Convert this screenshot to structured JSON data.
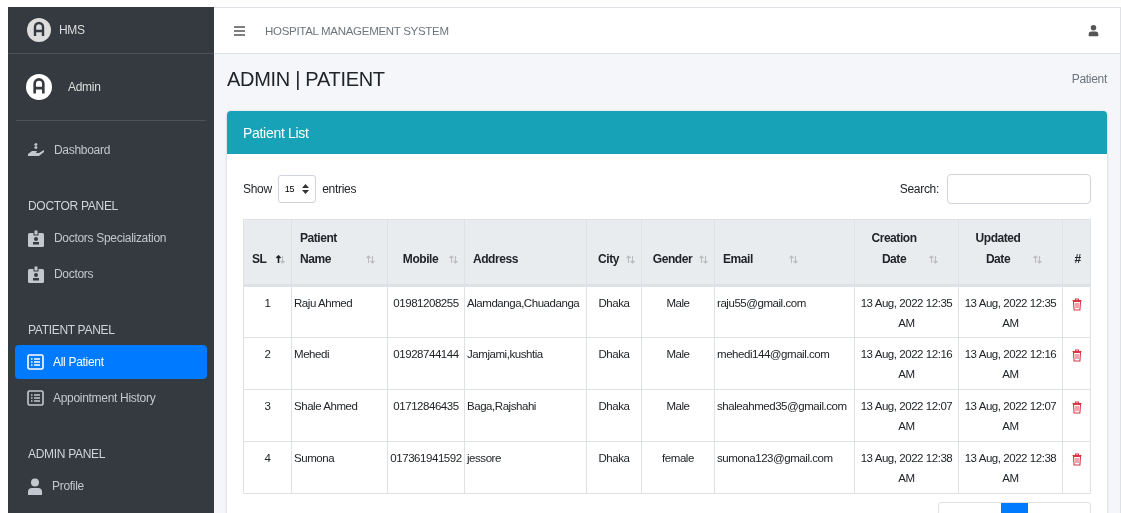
{
  "sidebar": {
    "brand": "HMS",
    "user": "Admin",
    "items": [
      {
        "kind": "link",
        "label": "Dashboard",
        "selected": false
      },
      {
        "kind": "header",
        "label": "DOCTOR PANEL"
      },
      {
        "kind": "link",
        "label": "Doctors Specialization",
        "selected": false
      },
      {
        "kind": "link",
        "label": "Doctors",
        "selected": false
      },
      {
        "kind": "header",
        "label": "PATIENT PANEL"
      },
      {
        "kind": "link",
        "label": "All Patient",
        "selected": true
      },
      {
        "kind": "link",
        "label": "Appointment History",
        "selected": false
      },
      {
        "kind": "header",
        "label": "ADMIN PANEL"
      },
      {
        "kind": "link",
        "label": "Profile",
        "selected": false
      }
    ]
  },
  "topbar": {
    "title": "HOSPITAL MANAGEMENT SYSTEM"
  },
  "page": {
    "title": "ADMIN | PATIENT",
    "breadcrumb": "Patient"
  },
  "card": {
    "title": "Patient List",
    "show_label": "Show",
    "page_size": "15",
    "entries_label": "entries",
    "search_label": "Search:"
  },
  "table": {
    "columns": [
      {
        "label": "SL",
        "sorted": true
      },
      {
        "label": "Patient Name",
        "sorted": false
      },
      {
        "label": "Mobile",
        "sorted": false
      },
      {
        "label": "Address"
      },
      {
        "label": "City",
        "sorted": false
      },
      {
        "label": "Gender",
        "sorted": false
      },
      {
        "label": "Email",
        "sorted": false
      },
      {
        "label": "Creation Date",
        "sorted": false
      },
      {
        "label": "Updated Date",
        "sorted": false
      },
      {
        "label": "#"
      }
    ],
    "rows": [
      [
        "1",
        "Raju Ahmed",
        "01981208255",
        "Alamdanga,Chuadanga",
        "Dhaka",
        "Male",
        "raju55@gmail.com",
        "13 Aug, 2022 12:35 AM",
        "13 Aug, 2022 12:35 AM"
      ],
      [
        "2",
        "Mehedi",
        "01928744144",
        "Jamjami,kushtia",
        "Dhaka",
        "Male",
        "mehedi144@gmail.com",
        "13 Aug, 2022 12:16 AM",
        "13 Aug, 2022 12:16 AM"
      ],
      [
        "3",
        "Shale Ahmed",
        "01712846435",
        "Baga,Rajshahi",
        "Dhaka",
        "Male",
        "shaleahmed35@gmail.com",
        "13 Aug, 2022 12:07 AM",
        "13 Aug, 2022 12:07 AM"
      ],
      [
        "4",
        "Sumona",
        "017361941592",
        "jessore",
        "Dhaka",
        "female",
        "sumona123@gmail.com",
        "13 Aug, 2022 12:38 AM",
        "13 Aug, 2022 12:38 AM"
      ]
    ]
  }
}
